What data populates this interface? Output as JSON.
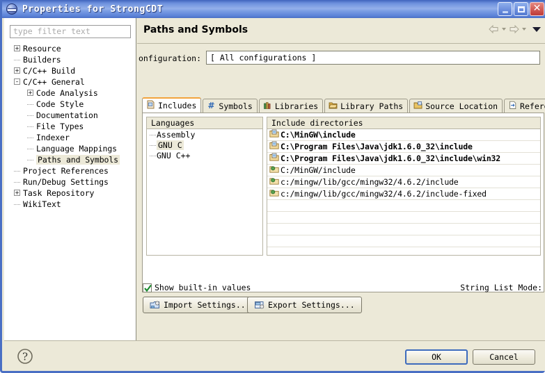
{
  "window": {
    "title": "Properties for StrongCDT",
    "icon": "eclipse-globe-icon",
    "buttons": {
      "minimize": "minimize-button",
      "maximize": "maximize-button",
      "close": "close-button"
    }
  },
  "sidebar": {
    "filter_placeholder": "type filter text",
    "filter_value": "",
    "tree": [
      {
        "label": "Resource",
        "depth": 0,
        "state": "collapsed"
      },
      {
        "label": "Builders",
        "depth": 0,
        "state": "leaf"
      },
      {
        "label": "C/C++ Build",
        "depth": 0,
        "state": "collapsed"
      },
      {
        "label": "C/C++ General",
        "depth": 0,
        "state": "expanded"
      },
      {
        "label": "Code Analysis",
        "depth": 1,
        "state": "collapsed"
      },
      {
        "label": "Code Style",
        "depth": 1,
        "state": "leaf"
      },
      {
        "label": "Documentation",
        "depth": 1,
        "state": "leaf"
      },
      {
        "label": "File Types",
        "depth": 1,
        "state": "leaf"
      },
      {
        "label": "Indexer",
        "depth": 1,
        "state": "leaf"
      },
      {
        "label": "Language Mappings",
        "depth": 1,
        "state": "leaf"
      },
      {
        "label": "Paths and Symbols",
        "depth": 1,
        "state": "leaf",
        "selected": true
      },
      {
        "label": "Project References",
        "depth": 0,
        "state": "leaf"
      },
      {
        "label": "Run/Debug Settings",
        "depth": 0,
        "state": "leaf"
      },
      {
        "label": "Task Repository",
        "depth": 0,
        "state": "collapsed"
      },
      {
        "label": "WikiText",
        "depth": 0,
        "state": "leaf"
      }
    ]
  },
  "page": {
    "title": "Paths and Symbols",
    "nav": {
      "back": "back-arrow-icon",
      "back_menu": "back-dropdown-caret",
      "forward": "forward-arrow-icon",
      "forward_menu": "forward-dropdown-caret",
      "menu": "view-menu-caret"
    },
    "configuration": {
      "label": "onfiguration:",
      "value": "[ All configurations ]"
    },
    "tabs": [
      {
        "label": "Includes",
        "icon": "includes-icon",
        "active": true
      },
      {
        "label": "Symbols",
        "icon": "symbols-hash-icon",
        "active": false
      },
      {
        "label": "Libraries",
        "icon": "libraries-books-icon",
        "active": false
      },
      {
        "label": "Library Paths",
        "icon": "library-paths-folder-icon",
        "active": false
      },
      {
        "label": "Source Location",
        "icon": "source-location-folder-icon",
        "active": false
      },
      {
        "label": "References",
        "icon": "references-page-icon",
        "active": false
      }
    ],
    "languages": {
      "header": "Languages",
      "items": [
        {
          "label": "Assembly",
          "selected": false
        },
        {
          "label": "GNU C",
          "selected": true
        },
        {
          "label": "GNU C++",
          "selected": false
        }
      ]
    },
    "include_directories": {
      "header": "Include directories",
      "items": [
        {
          "path": "C:\\MinGW\\include",
          "bold": true,
          "icon": "folder-workspace-icon"
        },
        {
          "path": "C:\\Program Files\\Java\\jdk1.6.0_32\\include",
          "bold": true,
          "icon": "folder-workspace-icon"
        },
        {
          "path": "C:\\Program Files\\Java\\jdk1.6.0_32\\include\\win32",
          "bold": true,
          "icon": "folder-workspace-icon"
        },
        {
          "path": "C:/MinGW/include",
          "bold": false,
          "icon": "folder-builtin-icon"
        },
        {
          "path": "c:/mingw/lib/gcc/mingw32/4.6.2/include",
          "bold": false,
          "icon": "folder-builtin-icon"
        },
        {
          "path": "c:/mingw/lib/gcc/mingw32/4.6.2/include-fixed",
          "bold": false,
          "icon": "folder-builtin-icon"
        }
      ]
    },
    "show_builtin": {
      "label": "Show built-in values",
      "checked": true
    },
    "string_list_mode_label": "String List Mode:",
    "import_button": "Import Settings...",
    "export_button": "Export Settings..."
  },
  "footer": {
    "help": "help-question-icon",
    "ok": "OK",
    "cancel": "Cancel"
  },
  "colors": {
    "title_bar": "#6d90dd",
    "dialog_bg": "#ece9d8",
    "active_tab_accent": "#f2a33c",
    "default_button_border": "#3d6bbd",
    "close_button": "#bd3b38"
  }
}
